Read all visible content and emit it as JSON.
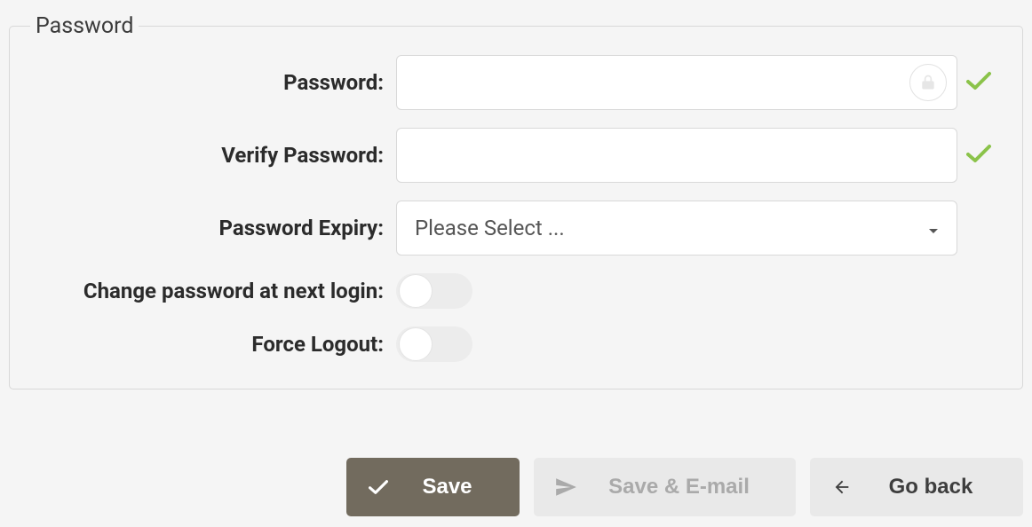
{
  "fieldset": {
    "legend": "Password",
    "password_label": "Password:",
    "verify_label": "Verify Password:",
    "expiry_label": "Password Expiry:",
    "expiry_placeholder": "Please Select ...",
    "change_next_login_label": "Change password at next login:",
    "force_logout_label": "Force Logout:",
    "password_value": "",
    "verify_value": "",
    "change_next_login": false,
    "force_logout": false
  },
  "buttons": {
    "save": "Save",
    "save_email": "Save & E-mail",
    "go_back": "Go back"
  }
}
